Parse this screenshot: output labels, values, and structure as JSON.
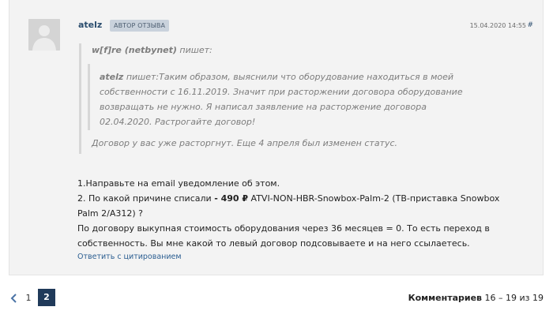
{
  "comment": {
    "author": "atelz",
    "badge": "АВТОР ОТЗЫВА",
    "date": "15.04.2020 14:55",
    "hash": "#",
    "outer_quote": {
      "author": "w[f]re (netbynet)",
      "verb": " пишет:",
      "inner_quote": {
        "author": "atelz",
        "text": " пишет:Таким образом, выяснили что оборудование находиться в моей собственности с 16.11.2019. Значит при расторжении договора оборудование возвращать не нужно. Я написал заявление на расторжение договора 02.04.2020. Растрогайте договор!"
      },
      "reply": "Договор у вас уже расторгнут. Еще 4 апреля был изменен статус."
    },
    "body": {
      "line1": "1.Направьте на email уведомление об этом.",
      "line2_pre": "2. По какой причине списали ",
      "line2_bold": "- 490 ₽",
      "line2_post": " ATVI-NON-HBR-Snowbox-Palm-2 (ТВ-приставка Snowbox Palm 2/A312) ?",
      "line3": "По договору выкупная стоимость оборудования через 36 месяцев = 0. То есть переход в собственность. Вы мне какой то левый договор подсовываете и на него ссылаетесь."
    },
    "reply_link": "Ответить с цитированием"
  },
  "pagination": {
    "prev_icon": "chevron-left-icon",
    "pages": [
      "1",
      "2"
    ],
    "current": "2",
    "count_label": "Комментариев",
    "count_value": " 16 – 19 из 19"
  },
  "colors": {
    "accent": "#2b4d6e",
    "link": "#2b5e91",
    "badge_bg": "#c9d2dc",
    "active_page": "#203a5a"
  }
}
